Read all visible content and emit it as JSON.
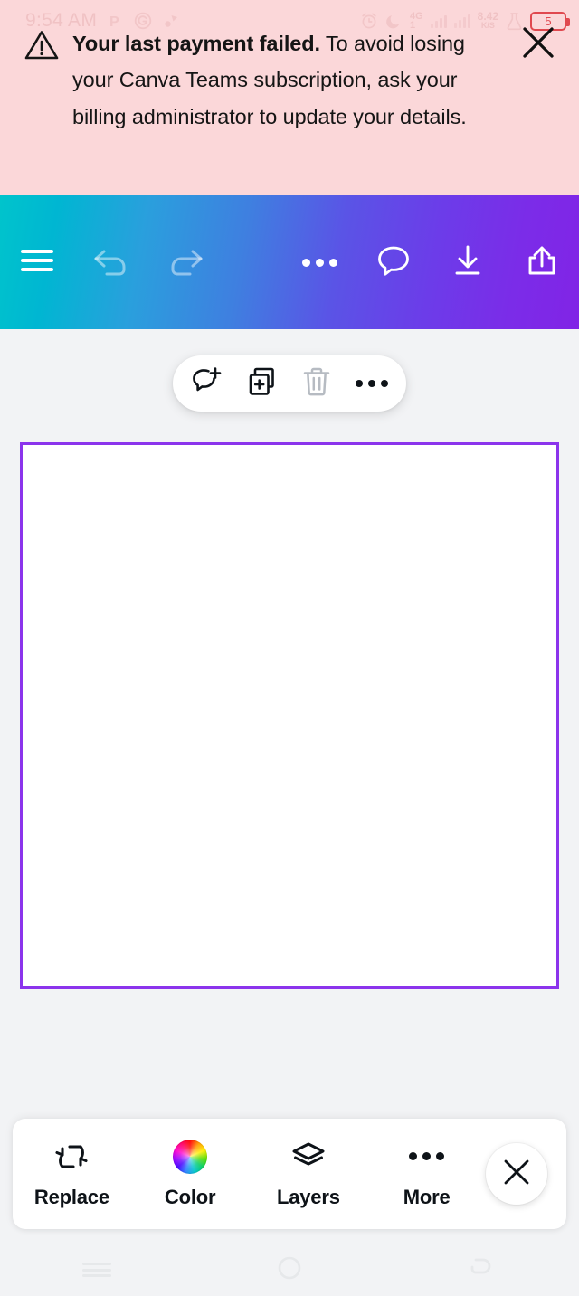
{
  "status_bar": {
    "time": "9:54 AM",
    "notification_icons": [
      "p-app-icon",
      "circle-g-app-icon",
      "badge-app-icon"
    ],
    "alarm_icon": "alarm-clock-icon",
    "dnd_icon": "moon-icon",
    "network_type": "4G",
    "network_sub": "1",
    "data_speed_value": "8.42",
    "data_speed_unit": "K/S",
    "flask_icon": "flask-icon",
    "battery_percent": "5"
  },
  "alert": {
    "icon": "warning-triangle-icon",
    "bold_text": "Your last payment failed.",
    "body_text": " To avoid losing your Canva Teams subscription, ask your billing administrator to update your details.",
    "close_icon": "close-icon",
    "background_color": "#fbd7d9"
  },
  "app_toolbar": {
    "gradient_start": "#00c4cc",
    "gradient_end": "#8124e6",
    "left_buttons": [
      {
        "name": "menu-button",
        "icon": "hamburger-menu-icon",
        "enabled": true
      },
      {
        "name": "undo-button",
        "icon": "undo-arrow-icon",
        "enabled": false
      },
      {
        "name": "redo-button",
        "icon": "redo-arrow-icon",
        "enabled": false
      }
    ],
    "right_buttons": [
      {
        "name": "more-options-button",
        "icon": "ellipsis-icon",
        "enabled": true
      },
      {
        "name": "comments-button",
        "icon": "speech-bubble-icon",
        "enabled": true
      },
      {
        "name": "download-button",
        "icon": "download-arrow-icon",
        "enabled": true
      },
      {
        "name": "share-button",
        "icon": "share-upload-icon",
        "enabled": true
      }
    ]
  },
  "element_toolbar": {
    "buttons": [
      {
        "name": "add-comment-button",
        "icon": "comment-plus-icon",
        "enabled": true
      },
      {
        "name": "duplicate-button",
        "icon": "duplicate-plus-icon",
        "enabled": true
      },
      {
        "name": "delete-button",
        "icon": "trash-icon",
        "enabled": false
      },
      {
        "name": "element-more-button",
        "icon": "ellipsis-icon",
        "enabled": true
      }
    ]
  },
  "canvas": {
    "page_background": "#ffffff",
    "selection_border_color": "#8b34ec",
    "editor_background": "#f2f3f5"
  },
  "bottom_bar": {
    "items": [
      {
        "label": "Replace",
        "icon": "swap-arrows-icon"
      },
      {
        "label": "Color",
        "icon": "color-wheel-icon"
      },
      {
        "label": "Layers",
        "icon": "layers-stack-icon"
      },
      {
        "label": "More",
        "icon": "ellipsis-icon"
      }
    ],
    "close_icon": "close-icon"
  },
  "nav_bar": {
    "recents_label": "recents-icon",
    "home_label": "home-circle-icon",
    "back_label": "back-arrow-icon"
  }
}
